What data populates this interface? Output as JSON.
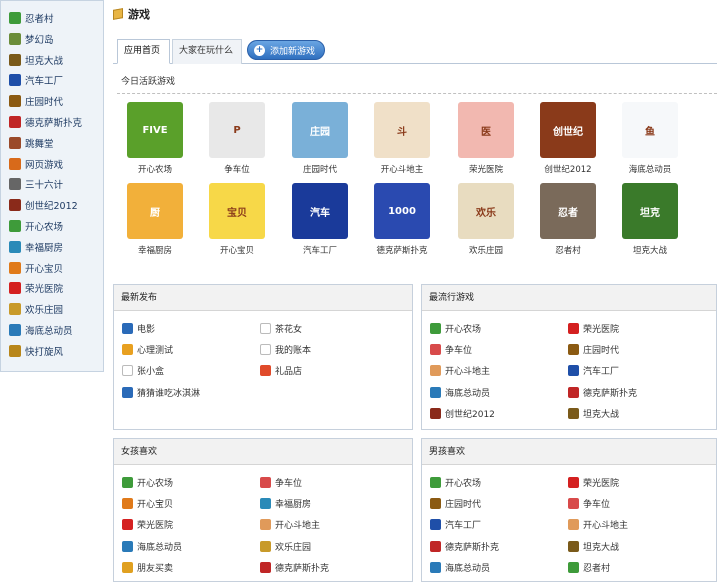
{
  "sidebar": {
    "items": [
      {
        "label": "忍者村",
        "icon": "ninja-icon",
        "color": "#3e9b3a"
      },
      {
        "label": "梦幻岛",
        "icon": "island-icon",
        "color": "#6b8d3a"
      },
      {
        "label": "坦克大战",
        "icon": "tank-icon",
        "color": "#7a5a1a"
      },
      {
        "label": "汽车工厂",
        "icon": "car-factory-icon",
        "color": "#1f4fa8"
      },
      {
        "label": "庄园时代",
        "icon": "manor-icon",
        "color": "#8b5a12"
      },
      {
        "label": "德克萨斯扑克",
        "icon": "poker-icon",
        "color": "#c02626"
      },
      {
        "label": "跳舞堂",
        "icon": "dance-icon",
        "color": "#9a4a2a"
      },
      {
        "label": "网页游戏",
        "icon": "web-game-icon",
        "color": "#d86a1a"
      },
      {
        "label": "三十六计",
        "icon": "strategy-icon",
        "color": "#666666"
      },
      {
        "label": "创世纪2012",
        "icon": "genesis-icon",
        "color": "#8a2a1a"
      },
      {
        "label": "开心农场",
        "icon": "farm-icon",
        "color": "#3e9b3a"
      },
      {
        "label": "幸福厨房",
        "icon": "kitchen-icon",
        "color": "#2a8ab8"
      },
      {
        "label": "开心宝贝",
        "icon": "baby-icon",
        "color": "#e07a1a"
      },
      {
        "label": "荣光医院",
        "icon": "hospital-icon",
        "color": "#d42020"
      },
      {
        "label": "欢乐庄园",
        "icon": "happy-manor-icon",
        "color": "#c89a2a"
      },
      {
        "label": "海底总动员",
        "icon": "sea-icon",
        "color": "#2a7ab8"
      },
      {
        "label": "快打旋风",
        "icon": "fighter-icon",
        "color": "#b8861a"
      }
    ]
  },
  "header": {
    "title": "游戏"
  },
  "tabs": [
    {
      "label": "应用首页"
    },
    {
      "label": "大家在玩什么"
    }
  ],
  "add_button": {
    "label": "添加新游戏"
  },
  "today_label": "今日活跃游戏",
  "games": [
    {
      "label": "开心农场",
      "icon": "farm-game-icon",
      "color": "#5aa02a",
      "text": "FIVE"
    },
    {
      "label": "争车位",
      "icon": "parking-game-icon",
      "color": "#e8e8e8",
      "text": "P"
    },
    {
      "label": "庄园时代",
      "icon": "manor-game-icon",
      "color": "#7ab0d8",
      "text": "庄园"
    },
    {
      "label": "开心斗地主",
      "icon": "landlord-game-icon",
      "color": "#f0e0c8",
      "text": "斗"
    },
    {
      "label": "荣光医院",
      "icon": "hospital-game-icon",
      "color": "#f2b8b0",
      "text": "医"
    },
    {
      "label": "创世纪2012",
      "icon": "genesis-game-icon",
      "color": "#8a3a1a",
      "text": "创世纪"
    },
    {
      "label": "海底总动员",
      "icon": "sea-game-icon",
      "color": "#f6f8fa",
      "text": "鱼"
    },
    {
      "label": "幸福厨房",
      "icon": "kitchen-game-icon",
      "color": "#f2b03a",
      "text": "厨"
    },
    {
      "label": "开心宝贝",
      "icon": "baby-game-icon",
      "color": "#f7d848",
      "text": "宝贝"
    },
    {
      "label": "汽车工厂",
      "icon": "car-game-icon",
      "color": "#1a3a9a",
      "text": "汽车"
    },
    {
      "label": "德克萨斯扑克",
      "icon": "poker-game-icon",
      "color": "#2a4ab0",
      "text": "1000"
    },
    {
      "label": "欢乐庄园",
      "icon": "happy-manor-game-icon",
      "color": "#e8dcc0",
      "text": "欢乐"
    },
    {
      "label": "忍者村",
      "icon": "ninja-game-icon",
      "color": "#7a6a5a",
      "text": "忍者"
    },
    {
      "label": "坦克大战",
      "icon": "tank-game-icon",
      "color": "#3a7a2a",
      "text": "坦克"
    }
  ],
  "panels": {
    "latest": {
      "title": "最新发布",
      "items": [
        {
          "label": "电影",
          "icon": "movie-icon",
          "color": "#2a6ab8"
        },
        {
          "label": "茶花女",
          "icon": "placeholder-icon",
          "color": "#ffffff"
        },
        {
          "label": "心理测试",
          "icon": "flask-icon",
          "color": "#e8a020"
        },
        {
          "label": "我的账本",
          "icon": "placeholder-icon",
          "color": "#ffffff"
        },
        {
          "label": "张小盒",
          "icon": "placeholder-icon",
          "color": "#ffffff"
        },
        {
          "label": "礼品店",
          "icon": "gift-icon",
          "color": "#e04a2a"
        },
        {
          "label": "猜猜谁吃冰淇淋",
          "icon": "globe-icon",
          "color": "#2a6ab8"
        }
      ]
    },
    "popular": {
      "title": "最流行游戏",
      "items": [
        {
          "label": "开心农场",
          "icon": "farm-icon",
          "color": "#3e9b3a"
        },
        {
          "label": "荣光医院",
          "icon": "hospital-icon",
          "color": "#d42020"
        },
        {
          "label": "争车位",
          "icon": "parking-icon",
          "color": "#d84a4a"
        },
        {
          "label": "庄园时代",
          "icon": "manor-icon",
          "color": "#8b5a12"
        },
        {
          "label": "开心斗地主",
          "icon": "landlord-icon",
          "color": "#e09a5a"
        },
        {
          "label": "汽车工厂",
          "icon": "car-factory-icon",
          "color": "#1f4fa8"
        },
        {
          "label": "海底总动员",
          "icon": "sea-icon",
          "color": "#2a7ab8"
        },
        {
          "label": "德克萨斯扑克",
          "icon": "poker-icon",
          "color": "#c02626"
        },
        {
          "label": "创世纪2012",
          "icon": "genesis-icon",
          "color": "#8a2a1a"
        },
        {
          "label": "坦克大战",
          "icon": "tank-icon",
          "color": "#7a5a1a"
        }
      ]
    },
    "girls": {
      "title": "女孩喜欢",
      "items": [
        {
          "label": "开心农场",
          "icon": "farm-icon",
          "color": "#3e9b3a"
        },
        {
          "label": "争车位",
          "icon": "parking-icon",
          "color": "#d84a4a"
        },
        {
          "label": "开心宝贝",
          "icon": "baby-icon",
          "color": "#e07a1a"
        },
        {
          "label": "幸福厨房",
          "icon": "kitchen-icon",
          "color": "#2a8ab8"
        },
        {
          "label": "荣光医院",
          "icon": "hospital-icon",
          "color": "#d42020"
        },
        {
          "label": "开心斗地主",
          "icon": "landlord-icon",
          "color": "#e09a5a"
        },
        {
          "label": "海底总动员",
          "icon": "sea-icon",
          "color": "#2a7ab8"
        },
        {
          "label": "欢乐庄园",
          "icon": "happy-manor-icon",
          "color": "#c89a2a"
        },
        {
          "label": "朋友买卖",
          "icon": "friend-trade-icon",
          "color": "#e0a020"
        },
        {
          "label": "德克萨斯扑克",
          "icon": "poker-icon",
          "color": "#c02626"
        }
      ]
    },
    "boys": {
      "title": "男孩喜欢",
      "items": [
        {
          "label": "开心农场",
          "icon": "farm-icon",
          "color": "#3e9b3a"
        },
        {
          "label": "荣光医院",
          "icon": "hospital-icon",
          "color": "#d42020"
        },
        {
          "label": "庄园时代",
          "icon": "manor-icon",
          "color": "#8b5a12"
        },
        {
          "label": "争车位",
          "icon": "parking-icon",
          "color": "#d84a4a"
        },
        {
          "label": "汽车工厂",
          "icon": "car-factory-icon",
          "color": "#1f4fa8"
        },
        {
          "label": "开心斗地主",
          "icon": "landlord-icon",
          "color": "#e09a5a"
        },
        {
          "label": "德克萨斯扑克",
          "icon": "poker-icon",
          "color": "#c02626"
        },
        {
          "label": "坦克大战",
          "icon": "tank-icon",
          "color": "#7a5a1a"
        },
        {
          "label": "海底总动员",
          "icon": "sea-icon",
          "color": "#2a7ab8"
        },
        {
          "label": "忍者村",
          "icon": "ninja-icon",
          "color": "#3e9b3a"
        }
      ]
    }
  }
}
